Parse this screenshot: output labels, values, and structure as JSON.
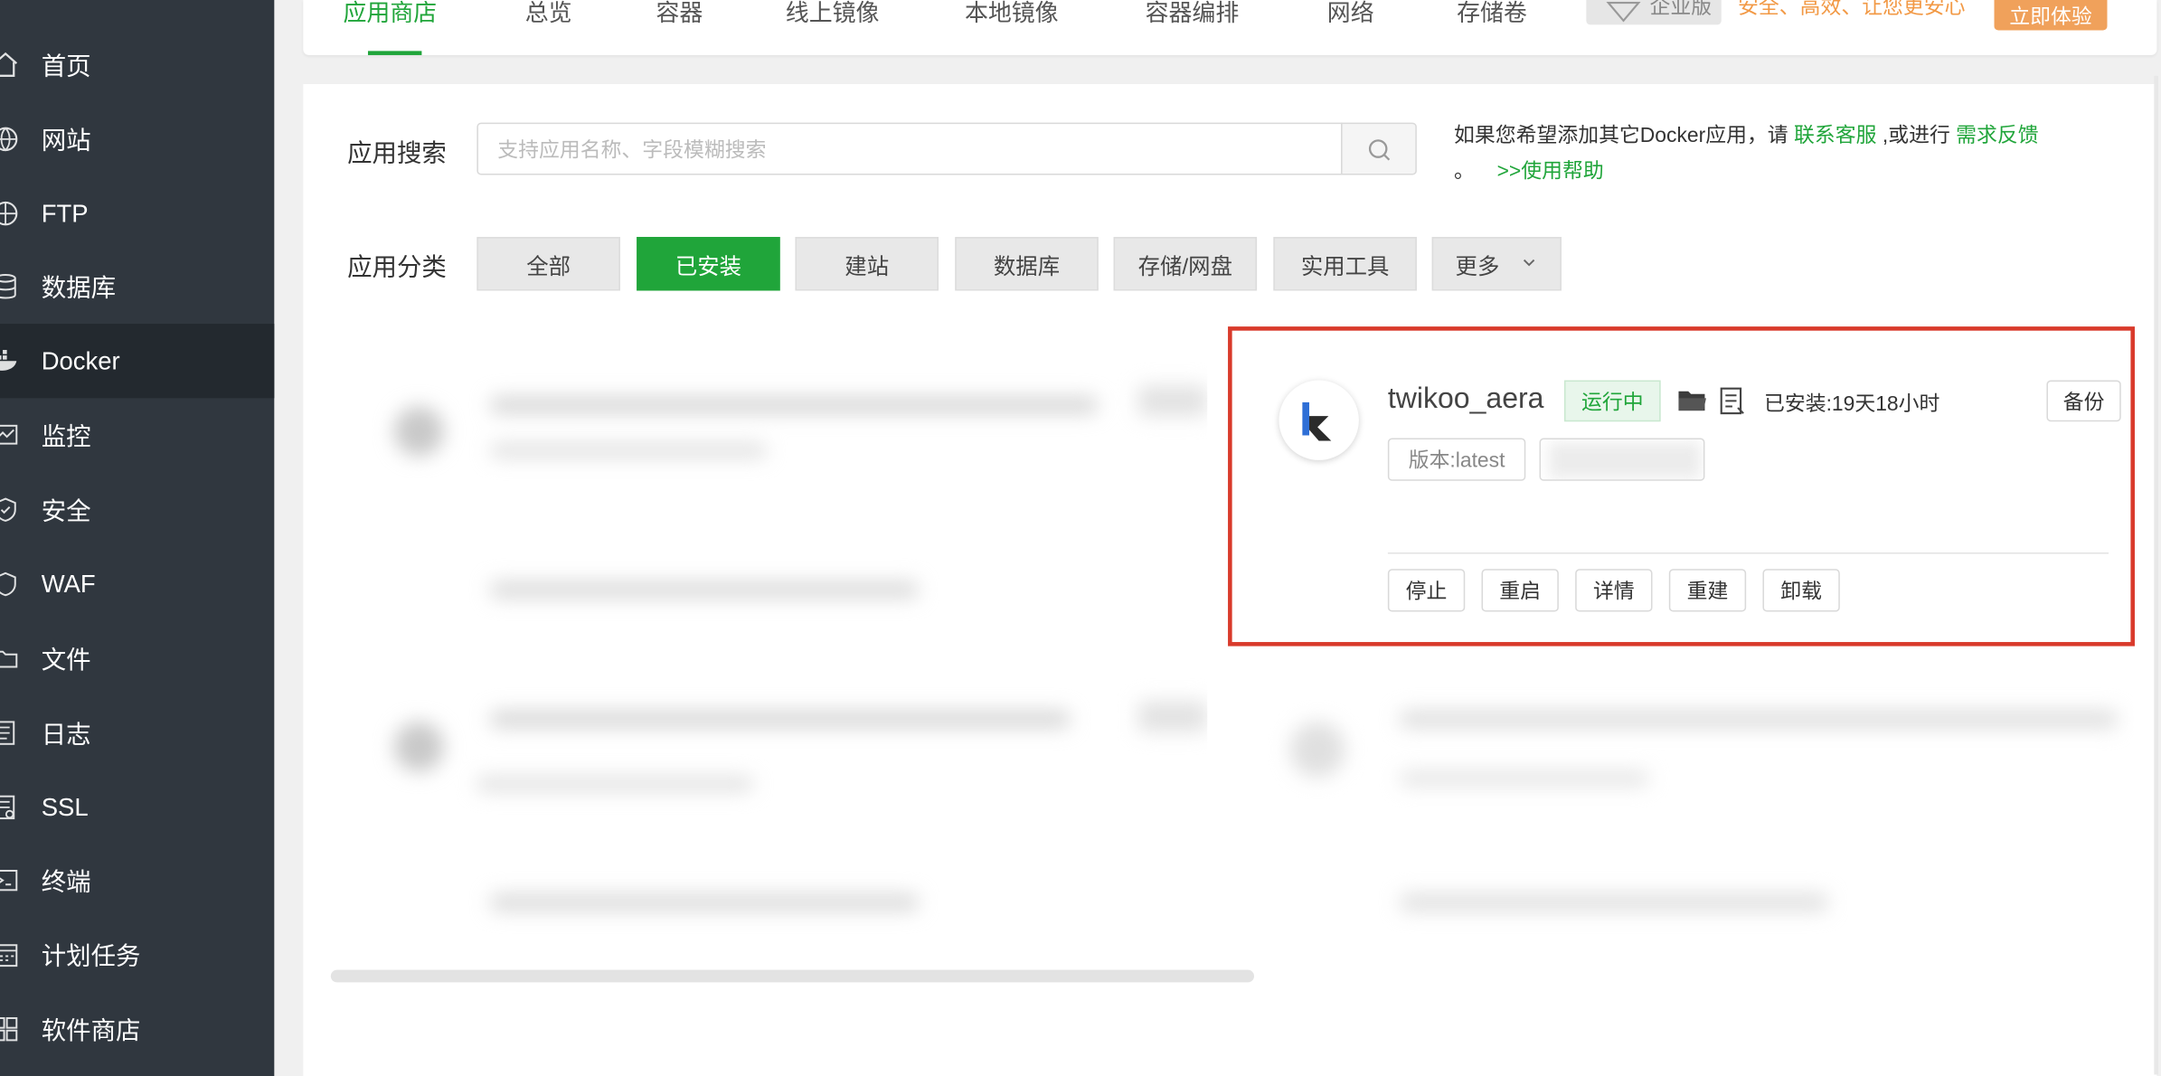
{
  "sidebar": {
    "items": [
      {
        "label": "首页",
        "icon": "home-icon"
      },
      {
        "label": "网站",
        "icon": "globe-icon"
      },
      {
        "label": "FTP",
        "icon": "ftp-icon"
      },
      {
        "label": "数据库",
        "icon": "database-icon"
      },
      {
        "label": "Docker",
        "icon": "docker-icon",
        "active": true
      },
      {
        "label": "监控",
        "icon": "monitor-icon"
      },
      {
        "label": "安全",
        "icon": "shield-icon"
      },
      {
        "label": "WAF",
        "icon": "waf-icon"
      },
      {
        "label": "文件",
        "icon": "folder-icon"
      },
      {
        "label": "日志",
        "icon": "log-icon"
      },
      {
        "label": "SSL",
        "icon": "ssl-icon"
      },
      {
        "label": "终端",
        "icon": "terminal-icon"
      },
      {
        "label": "计划任务",
        "icon": "calendar-icon"
      },
      {
        "label": "软件商店",
        "icon": "apps-icon"
      }
    ]
  },
  "tabs": [
    {
      "label": "应用商店",
      "active": true
    },
    {
      "label": "总览"
    },
    {
      "label": "容器"
    },
    {
      "label": "线上镜像"
    },
    {
      "label": "本地镜像"
    },
    {
      "label": "容器编排"
    },
    {
      "label": "网络"
    },
    {
      "label": "存储卷"
    }
  ],
  "promo": {
    "edition_label": "企业版",
    "slogan": "安全、高效、让您更安心",
    "try_label": "立即体验"
  },
  "search": {
    "label": "应用搜索",
    "placeholder": "支持应用名称、字段模糊搜索"
  },
  "tip": {
    "prefix": "如果您希望添加其它Docker应用，请",
    "contact_link": "联系客服",
    "middle": ",或进行",
    "feedback_link": "需求反馈",
    "suffix": "。",
    "help_link": ">>使用帮助"
  },
  "categories": {
    "label": "应用分类",
    "items": [
      {
        "label": "全部"
      },
      {
        "label": "已安装",
        "active": true
      },
      {
        "label": "建站"
      },
      {
        "label": "数据库"
      },
      {
        "label": "存储/网盘"
      },
      {
        "label": "实用工具"
      }
    ],
    "more_label": "更多"
  },
  "app": {
    "name": "twikoo_aera",
    "status": "运行中",
    "installed": "已安装:19天18小时",
    "version": "版本:latest",
    "backup_label": "备份",
    "actions": [
      "停止",
      "重启",
      "详情",
      "重建",
      "卸载"
    ]
  },
  "colors": {
    "accent": "#20a53a",
    "sidebar_bg": "#30373f",
    "highlight": "#d93a2b",
    "promo": "#f29945"
  }
}
